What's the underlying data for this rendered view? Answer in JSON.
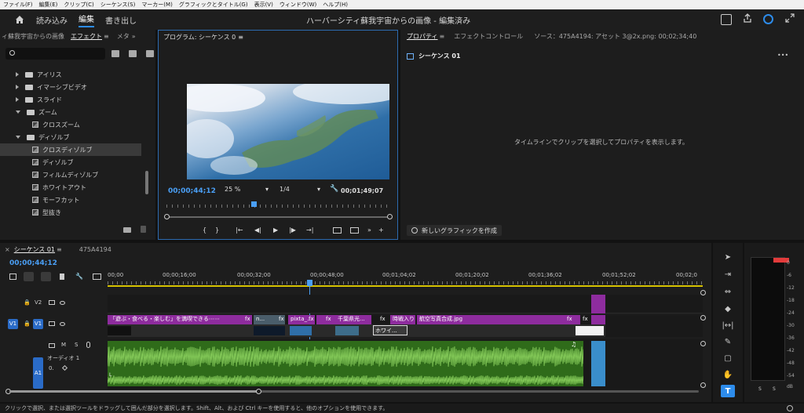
{
  "menu": [
    "ファイル(F)",
    "編集(E)",
    "クリップ(C)",
    "シーケンス(S)",
    "マーカー(M)",
    "グラフィックとタイトル(G)",
    "表示(V)",
    "ウィンドウ(W)",
    "ヘルプ(H)"
  ],
  "workspace_tabs": {
    "import": "読み込み",
    "edit": "編集",
    "export": "書き出し"
  },
  "window_title": "ハーバーシティ蘇我宇宙からの画像 - 編集済み",
  "left_panel": {
    "tabs": [
      "ィ蘇我宇宙からの画像",
      "エフェクト",
      "メタ"
    ],
    "tab_menu": "≡",
    "more": "»",
    "search_placeholder": "",
    "tree": [
      {
        "label": "アイリス",
        "type": "folder"
      },
      {
        "label": "イマーシブビデオ",
        "type": "folder"
      },
      {
        "label": "スライド",
        "type": "folder"
      },
      {
        "label": "ズーム",
        "type": "folder-open"
      },
      {
        "label": "クロスズーム",
        "type": "effect"
      },
      {
        "label": "ディゾルブ",
        "type": "folder-open"
      },
      {
        "label": "クロスディゾルブ",
        "type": "effect",
        "selected": true
      },
      {
        "label": "ディゾルブ",
        "type": "effect"
      },
      {
        "label": "フィルムディゾルブ",
        "type": "effect"
      },
      {
        "label": "ホワイトアウト",
        "type": "effect"
      },
      {
        "label": "モーフカット",
        "type": "effect"
      },
      {
        "label": "型抜き",
        "type": "effect"
      }
    ]
  },
  "program": {
    "title": "プログラム: シーケンス 0",
    "menu": "≡",
    "timecode": "00;00;44;12",
    "zoom": "25 %",
    "resolution": "1/4",
    "duration": "00;01;49;07",
    "controls": [
      "{",
      "}",
      "|←",
      "◀|",
      "▶",
      "|▶",
      "→|"
    ],
    "playhead_fraction": 0.39
  },
  "properties": {
    "tabs": {
      "props": "プロパティ",
      "menu": "≡",
      "effect_controls": "エフェクトコントロール",
      "source": "ソース：475A4194: アセット 3@2x.png: 00;02;34;40"
    },
    "sequence": "シーケンス 01",
    "more": "•••",
    "empty_message": "タイムラインでクリップを選択してプロパティを表示します。",
    "new_graphic": "新しいグラフィックを作成"
  },
  "timeline": {
    "close": "×",
    "tab": "シーケンス 01",
    "tab_menu": "≡",
    "tab2": "475A4194",
    "timecode": "00;00;44;12",
    "ruler": [
      "00;00",
      "00;00;16;00",
      "00;00;32;00",
      "00;00;48;00",
      "00;01;04;02",
      "00;01;20;02",
      "00;01;36;02",
      "00;01;52;02",
      "00;02;0"
    ],
    "tracks": {
      "v2": "V2",
      "v1": "V1",
      "a1": "A1",
      "audio_name": "オーディオ 1",
      "m": "M",
      "s": "S",
      "vol": "0."
    },
    "v1_clips": [
      {
        "label": "「遊ぶ・食べる・楽しむ」を満喫できる⋯⋯"
      },
      {
        "label": "fx"
      },
      {
        "label": "n..."
      },
      {
        "label": "fx"
      },
      {
        "label": "pixta_..."
      },
      {
        "label": "fx"
      },
      {
        "label": "fx"
      },
      {
        "label": "千葉県光..."
      },
      {
        "label": "fx"
      },
      {
        "label": "時戦入り"
      },
      {
        "label": "航空写真合成.jpg"
      },
      {
        "label": "fx"
      },
      {
        "label": "fx"
      },
      {
        "label": "ホワイ..."
      }
    ]
  },
  "meter": {
    "labels": [
      "0",
      "-6",
      "-12",
      "-18",
      "-24",
      "-30",
      "-36",
      "-42",
      "-48",
      "-54",
      "dB"
    ],
    "solo": [
      "S",
      "S"
    ]
  },
  "status": "クリックで選択、または選択ツールをドラッグして囲んだ部分を選択します。Shift、Alt、および Ctrl キーを使用すると、他のオプションを使用できます。",
  "colors": {
    "accent": "#2d8ceb",
    "video_clip": "#8e2c9e",
    "audio_clip": "#2f6b1a",
    "audio_wave": "#7fc455"
  }
}
